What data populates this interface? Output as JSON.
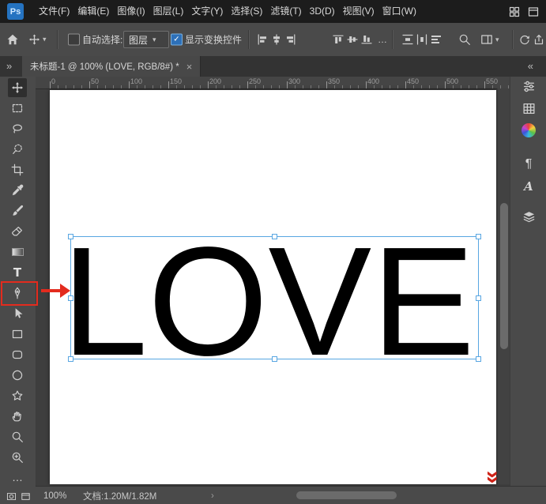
{
  "colors": {
    "selection_blue": "#58a6e2",
    "annotation_red": "#e32b1e",
    "canvas_white": "#ffffff",
    "text_black": "#000000",
    "checkbox_blue": "#2d70b8",
    "ui_dark": "#1c1c1c",
    "ui_panel": "#4a4a4a"
  },
  "menu_bar": {
    "logo_text": "Ps",
    "items": [
      "文件(F)",
      "编辑(E)",
      "图像(I)",
      "图层(L)",
      "文字(Y)",
      "选择(S)",
      "滤镜(T)",
      "3D(D)",
      "视图(V)",
      "窗口(W)"
    ]
  },
  "options_bar": {
    "auto_select_label": "自动选择:",
    "auto_select_value": "图层",
    "show_transform_label": "显示变换控件"
  },
  "tab_bar": {
    "tab_title": "未标题-1 @ 100% (LOVE, RGB/8#) *"
  },
  "ruler": {
    "labels": [
      "0",
      "50",
      "100",
      "150",
      "200",
      "250",
      "300",
      "350",
      "400",
      "450",
      "500",
      "550"
    ]
  },
  "toolbar": {
    "tools": [
      "move",
      "rectangular-marquee",
      "lasso",
      "quick-selection",
      "crop",
      "eyedropper",
      "brush",
      "eraser",
      "gradient",
      "type",
      "pen",
      "path-selection",
      "rectangle",
      "rounded-rectangle",
      "ellipse",
      "custom-shape",
      "hand",
      "zoom"
    ],
    "type_tool_glyph": "T"
  },
  "canvas": {
    "text_content": "LOVE"
  },
  "status_bar": {
    "zoom_level": "100%",
    "document_info": "文档:1.20M/1.82M"
  },
  "icons": {
    "ellipsis": "…",
    "chevron_down": "▾",
    "chevron_right": "›",
    "double_chevron_right": "»",
    "double_chevron_left": "«",
    "close": "×",
    "check": "✓",
    "paragraph": "¶",
    "character": "A"
  }
}
